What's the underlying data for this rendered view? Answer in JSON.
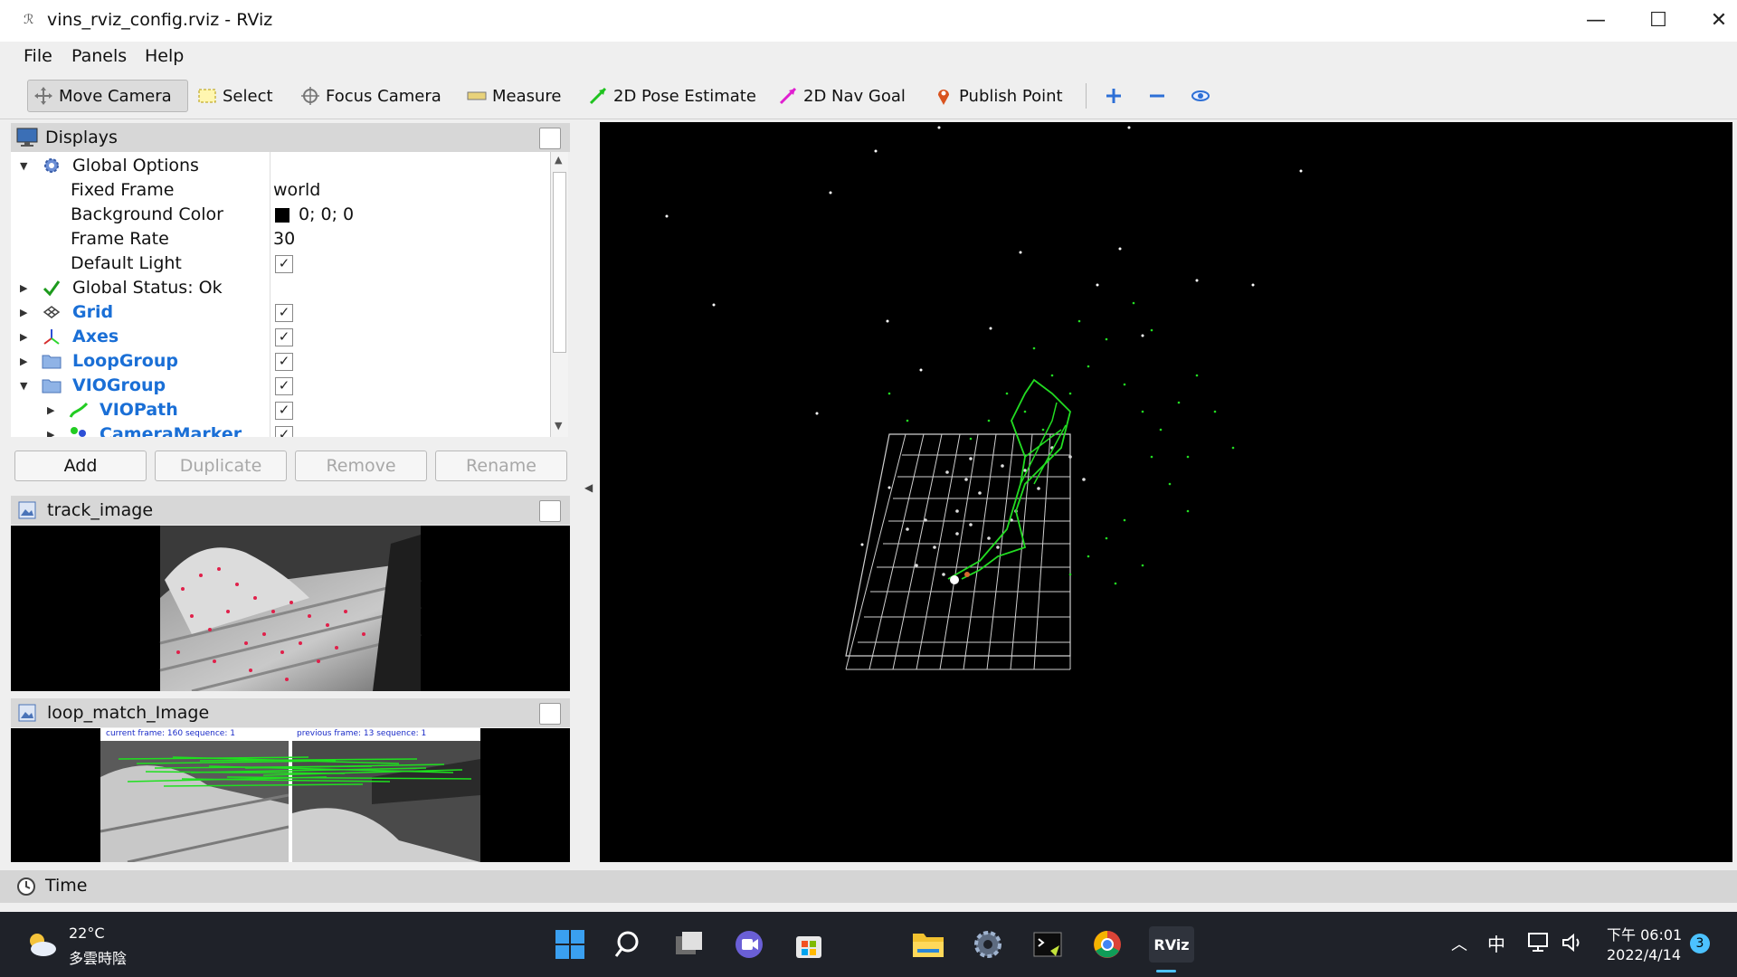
{
  "window": {
    "title": "vins_rviz_config.rviz - RViz",
    "minimize": "—",
    "maximize": "☐",
    "close": "✕"
  },
  "menu": {
    "file": "File",
    "panels": "Panels",
    "help": "Help"
  },
  "toolbar": {
    "move_camera": "Move Camera",
    "select": "Select",
    "focus_camera": "Focus Camera",
    "measure": "Measure",
    "pose_estimate": "2D Pose Estimate",
    "nav_goal": "2D Nav Goal",
    "publish_point": "Publish Point"
  },
  "displays": {
    "title": "Displays",
    "global_options": "Global Options",
    "fixed_frame_label": "Fixed Frame",
    "fixed_frame_value": "world",
    "background_color_label": "Background Color",
    "background_color_value": "0; 0; 0",
    "frame_rate_label": "Frame Rate",
    "frame_rate_value": "30",
    "default_light_label": "Default Light",
    "global_status": "Global Status: Ok",
    "grid": "Grid",
    "axes": "Axes",
    "loop_group": "LoopGroup",
    "vio_group": "VIOGroup",
    "vio_path": "VIOPath",
    "camera_marker": "CameraMarker",
    "check": "✓"
  },
  "buttons": {
    "add": "Add",
    "duplicate": "Duplicate",
    "remove": "Remove",
    "rename": "Rename"
  },
  "panels": {
    "track_image": "track_image",
    "loop_match_image": "loop_match_Image",
    "loop_current": "current frame: 160   sequence: 1",
    "loop_previous": "previous frame: 13   sequence: 1"
  },
  "time": {
    "label": "Time"
  },
  "taskbar": {
    "temperature": "22°C",
    "weather": "多雲時陰",
    "ime": "中",
    "time": "下午 06:01",
    "date": "2022/4/14",
    "notifications": "3",
    "rviz_label": "RViz"
  },
  "colors": {
    "accent_blue": "#1a6fd6",
    "path_green": "#22dd22",
    "viewport_bg": "#000000"
  }
}
